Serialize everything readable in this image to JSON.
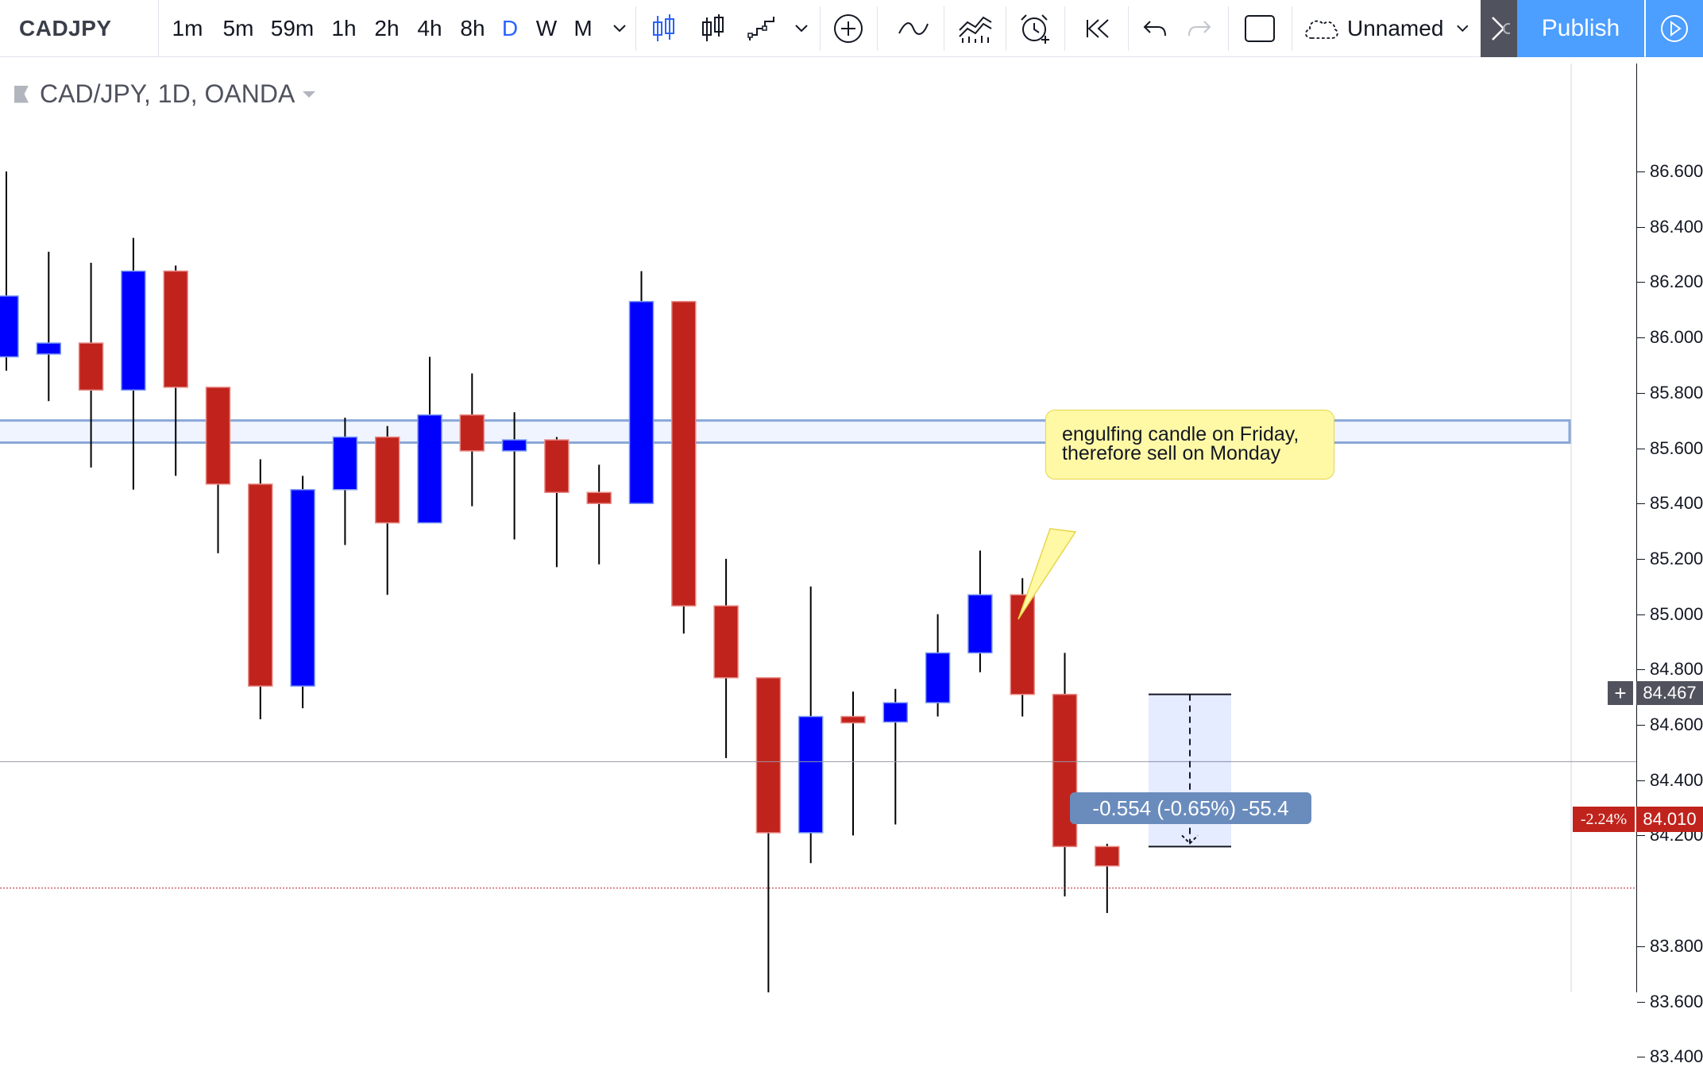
{
  "toolbar": {
    "symbol": "CADJPY",
    "timeframes": [
      "1m",
      "5m",
      "59m",
      "1h",
      "2h",
      "4h",
      "8h",
      "D",
      "W",
      "M"
    ],
    "active_timeframe": "D",
    "layout_name": "Unnamed",
    "publish_label": "Publish"
  },
  "legend": {
    "title": "CAD/JPY, 1D, OANDA"
  },
  "annotation": {
    "line1": "engulfing candle on Friday,",
    "line2": "therefore sell on Monday"
  },
  "measure": {
    "label": "-0.554 (-0.65%) -55.4"
  },
  "price_scale": {
    "labels": [
      "86.600",
      "86.400",
      "86.200",
      "86.000",
      "85.800",
      "85.600",
      "85.400",
      "85.200",
      "85.000",
      "84.800",
      "84.600",
      "84.400",
      "84.200",
      "83.800",
      "83.600",
      "83.400"
    ],
    "crosshair_price": "84.467",
    "last_price": "84.010",
    "pct_change": "-2.24%"
  },
  "colors": {
    "up": "#0000ff",
    "down": "#c0231c",
    "accent": "#2962ff",
    "publish": "#4c9eff",
    "zone": "#2962ff"
  },
  "chart_data": {
    "type": "candlestick",
    "symbol": "CAD/JPY",
    "interval": "1D",
    "source": "OANDA",
    "ylim": [
      83.4,
      86.7
    ],
    "candles": [
      {
        "o": 85.93,
        "h": 86.6,
        "l": 85.88,
        "c": 86.15
      },
      {
        "o": 85.94,
        "h": 86.31,
        "l": 85.77,
        "c": 85.98
      },
      {
        "o": 85.98,
        "h": 86.27,
        "l": 85.53,
        "c": 85.81
      },
      {
        "o": 85.81,
        "h": 86.36,
        "l": 85.45,
        "c": 86.24
      },
      {
        "o": 86.24,
        "h": 86.26,
        "l": 85.5,
        "c": 85.82
      },
      {
        "o": 85.82,
        "h": 85.82,
        "l": 85.22,
        "c": 85.47
      },
      {
        "o": 85.47,
        "h": 85.56,
        "l": 84.62,
        "c": 84.74
      },
      {
        "o": 84.74,
        "h": 85.5,
        "l": 84.66,
        "c": 85.45
      },
      {
        "o": 85.45,
        "h": 85.71,
        "l": 85.25,
        "c": 85.64
      },
      {
        "o": 85.64,
        "h": 85.68,
        "l": 85.07,
        "c": 85.33
      },
      {
        "o": 85.33,
        "h": 85.93,
        "l": 85.33,
        "c": 85.72
      },
      {
        "o": 85.72,
        "h": 85.87,
        "l": 85.39,
        "c": 85.59
      },
      {
        "o": 85.59,
        "h": 85.73,
        "l": 85.27,
        "c": 85.63
      },
      {
        "o": 85.63,
        "h": 85.64,
        "l": 85.17,
        "c": 85.44
      },
      {
        "o": 85.44,
        "h": 85.54,
        "l": 85.18,
        "c": 85.4
      },
      {
        "o": 85.4,
        "h": 86.24,
        "l": 85.4,
        "c": 86.13
      },
      {
        "o": 86.13,
        "h": 86.13,
        "l": 84.93,
        "c": 85.03
      },
      {
        "o": 85.03,
        "h": 85.2,
        "l": 84.48,
        "c": 84.77
      },
      {
        "o": 84.77,
        "h": 84.77,
        "l": 83.56,
        "c": 84.21
      },
      {
        "o": 84.21,
        "h": 85.1,
        "l": 84.1,
        "c": 84.63
      },
      {
        "o": 84.63,
        "h": 84.72,
        "l": 84.2,
        "c": 84.61
      },
      {
        "o": 84.61,
        "h": 84.73,
        "l": 84.24,
        "c": 84.68
      },
      {
        "o": 84.68,
        "h": 85.0,
        "l": 84.63,
        "c": 84.86
      },
      {
        "o": 84.86,
        "h": 85.23,
        "l": 84.79,
        "c": 85.07
      },
      {
        "o": 85.07,
        "h": 85.13,
        "l": 84.63,
        "c": 84.71
      },
      {
        "o": 84.71,
        "h": 84.86,
        "l": 83.98,
        "c": 84.16
      },
      {
        "o": 84.16,
        "h": 84.17,
        "l": 83.92,
        "c": 84.09
      }
    ],
    "zone": {
      "top": 85.7,
      "bottom": 85.62
    },
    "measure": {
      "from": 84.71,
      "to": 84.16
    },
    "crosshair_price": 84.467,
    "last_price": 84.01
  }
}
